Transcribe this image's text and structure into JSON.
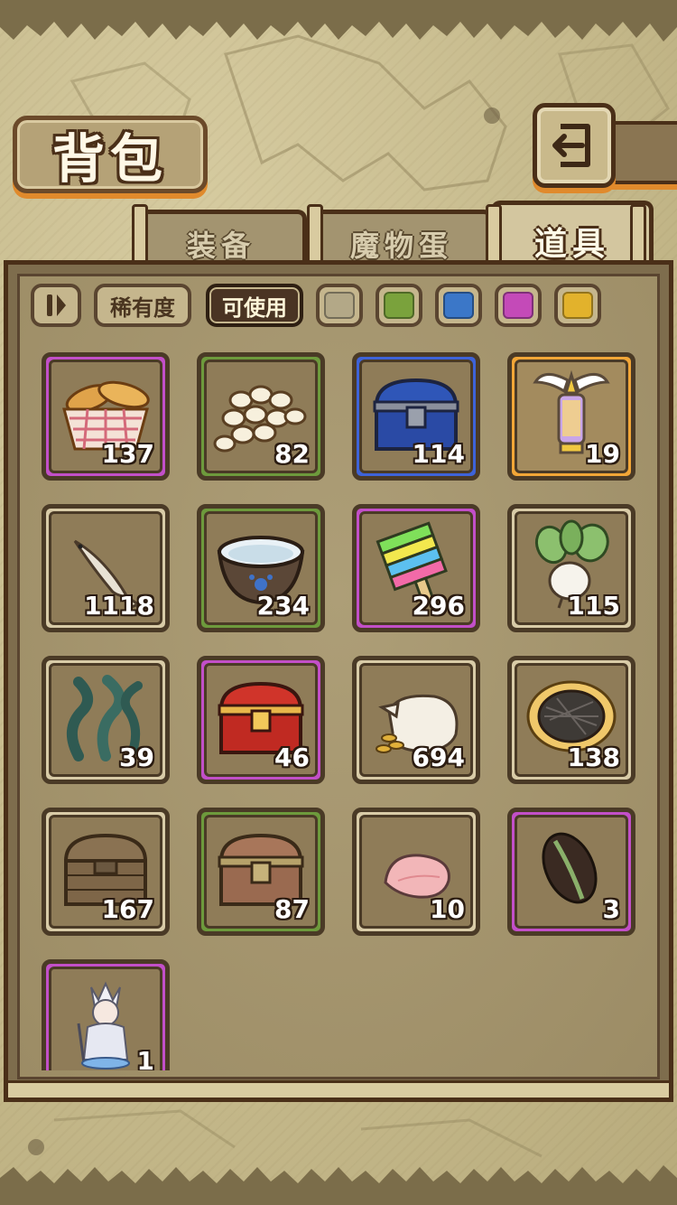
{
  "header": {
    "title": "背包"
  },
  "tabs": [
    {
      "label": "装备",
      "active": false
    },
    {
      "label": "魔物蛋",
      "active": false
    },
    {
      "label": "道具",
      "active": true
    }
  ],
  "filters": {
    "sort_icon": "pause-sort-icon",
    "rarity_label": "稀有度",
    "usable_label": "可使用",
    "swatches": [
      {
        "name": "gray",
        "color": "#b3a887"
      },
      {
        "name": "green",
        "color": "#7aa23c"
      },
      {
        "name": "blue",
        "color": "#3b77c8"
      },
      {
        "name": "purple",
        "color": "#c44ab8"
      },
      {
        "name": "gold",
        "color": "#e2b22c"
      }
    ]
  },
  "items": [
    {
      "name": "bread-basket",
      "count": "137",
      "rarity": "purple"
    },
    {
      "name": "eggs-pile",
      "count": "82",
      "rarity": "green"
    },
    {
      "name": "blue-chest",
      "count": "114",
      "rarity": "blue"
    },
    {
      "name": "winged-lantern",
      "count": "19",
      "rarity": "gold"
    },
    {
      "name": "fish",
      "count": "1118",
      "rarity": "gray"
    },
    {
      "name": "water-bowl",
      "count": "234",
      "rarity": "green"
    },
    {
      "name": "rainbow-popsicle",
      "count": "296",
      "rarity": "purple"
    },
    {
      "name": "turnip",
      "count": "115",
      "rarity": "gray"
    },
    {
      "name": "seaweed",
      "count": "39",
      "rarity": "gray"
    },
    {
      "name": "red-chest",
      "count": "46",
      "rarity": "purple"
    },
    {
      "name": "coin-sack",
      "count": "694",
      "rarity": "gray"
    },
    {
      "name": "pie",
      "count": "138",
      "rarity": "gray"
    },
    {
      "name": "wooden-chest",
      "count": "167",
      "rarity": "gray"
    },
    {
      "name": "bronze-chest",
      "count": "87",
      "rarity": "green"
    },
    {
      "name": "pink-petal",
      "count": "10",
      "rarity": "gray"
    },
    {
      "name": "cocoa-bean",
      "count": "3",
      "rarity": "purple"
    },
    {
      "name": "character-figure",
      "count": "1",
      "rarity": "purple"
    }
  ]
}
